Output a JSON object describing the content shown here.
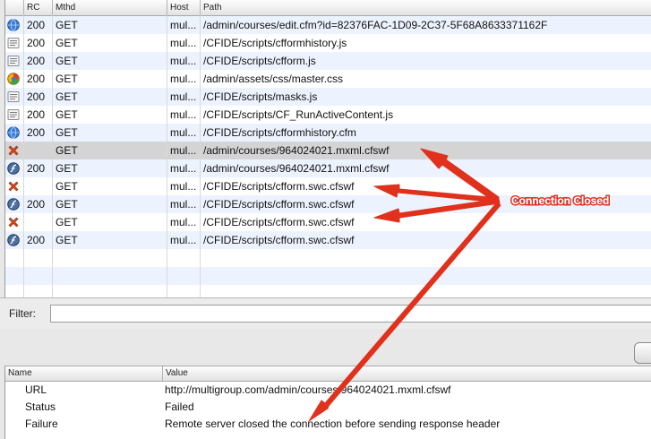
{
  "table": {
    "columns": [
      "RC",
      "Mthd",
      "Host",
      "Path"
    ],
    "rows": [
      {
        "icon": "globe",
        "rc": "200",
        "method": "GET",
        "host": "mul...",
        "path": "/admin/courses/edit.cfm?id=82376FAC-1D09-2C37-5F68A8633371162F"
      },
      {
        "icon": "document",
        "rc": "200",
        "method": "GET",
        "host": "mul...",
        "path": "/CFIDE/scripts/cfformhistory.js"
      },
      {
        "icon": "document",
        "rc": "200",
        "method": "GET",
        "host": "mul...",
        "path": "/CFIDE/scripts/cfform.js"
      },
      {
        "icon": "css",
        "rc": "200",
        "method": "GET",
        "host": "mul...",
        "path": "/admin/assets/css/master.css"
      },
      {
        "icon": "document",
        "rc": "200",
        "method": "GET",
        "host": "mul...",
        "path": "/CFIDE/scripts/masks.js"
      },
      {
        "icon": "document",
        "rc": "200",
        "method": "GET",
        "host": "mul...",
        "path": "/CFIDE/scripts/CF_RunActiveContent.js"
      },
      {
        "icon": "globe",
        "rc": "200",
        "method": "GET",
        "host": "mul...",
        "path": "/CFIDE/scripts/cfformhistory.cfm"
      },
      {
        "icon": "error",
        "rc": "",
        "method": "GET",
        "host": "mul...",
        "path": "/admin/courses/964024021.mxml.cfswf"
      },
      {
        "icon": "flash",
        "rc": "200",
        "method": "GET",
        "host": "mul...",
        "path": "/admin/courses/964024021.mxml.cfswf"
      },
      {
        "icon": "error",
        "rc": "",
        "method": "GET",
        "host": "mul...",
        "path": "/CFIDE/scripts/cfform.swc.cfswf"
      },
      {
        "icon": "flash",
        "rc": "200",
        "method": "GET",
        "host": "mul...",
        "path": "/CFIDE/scripts/cfform.swc.cfswf"
      },
      {
        "icon": "error",
        "rc": "",
        "method": "GET",
        "host": "mul...",
        "path": "/CFIDE/scripts/cfform.swc.cfswf"
      },
      {
        "icon": "flash",
        "rc": "200",
        "method": "GET",
        "host": "mul...",
        "path": "/CFIDE/scripts/cfform.swc.cfswf"
      }
    ],
    "selected_index": 7
  },
  "filter": {
    "label": "Filter:",
    "value": ""
  },
  "details": {
    "columns": [
      "Name",
      "Value"
    ],
    "rows": [
      {
        "name": "URL",
        "value": "http://multigroup.com/admin/courses/964024021.mxml.cfswf"
      },
      {
        "name": "Status",
        "value": "Failed"
      },
      {
        "name": "Failure",
        "value": "Remote server closed the connection before sending response header"
      },
      {
        "name": "",
        "value": ""
      }
    ]
  },
  "annotation": {
    "text": "Connection Closed",
    "color": "#e0311c"
  },
  "colors": {
    "accent_red": "#e0311c",
    "row_alt": "#edf3fe",
    "row_selected": "#d4d4d4"
  }
}
